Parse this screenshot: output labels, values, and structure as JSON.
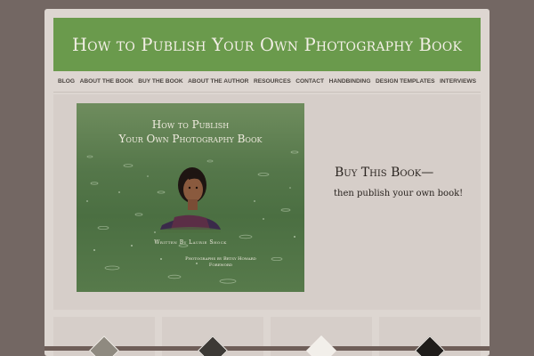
{
  "site": {
    "title": "How to Publish Your Own Photography Book"
  },
  "nav": {
    "items": [
      "BLOG",
      "ABOUT THE BOOK",
      "BUY THE BOOK",
      "ABOUT THE AUTHOR",
      "RESOURCES",
      "CONTACT",
      "HANDBINDING",
      "DESIGN TEMPLATES",
      "INTERVIEWS"
    ]
  },
  "feature": {
    "cover": {
      "title_line1": "How to Publish",
      "title_line2": "Your Own Photography Book",
      "author": "Written By Laurie Shock",
      "credit_line1": "Photographs by Betsy Howard",
      "credit_line2": "Foreword"
    },
    "buy_heading": "Buy This Book—",
    "buy_sub": "then publish your own book!"
  },
  "colors": {
    "background": "#736763",
    "page": "#ddd6d1",
    "header": "#6a9a4c",
    "header_text": "#f3efe6"
  }
}
